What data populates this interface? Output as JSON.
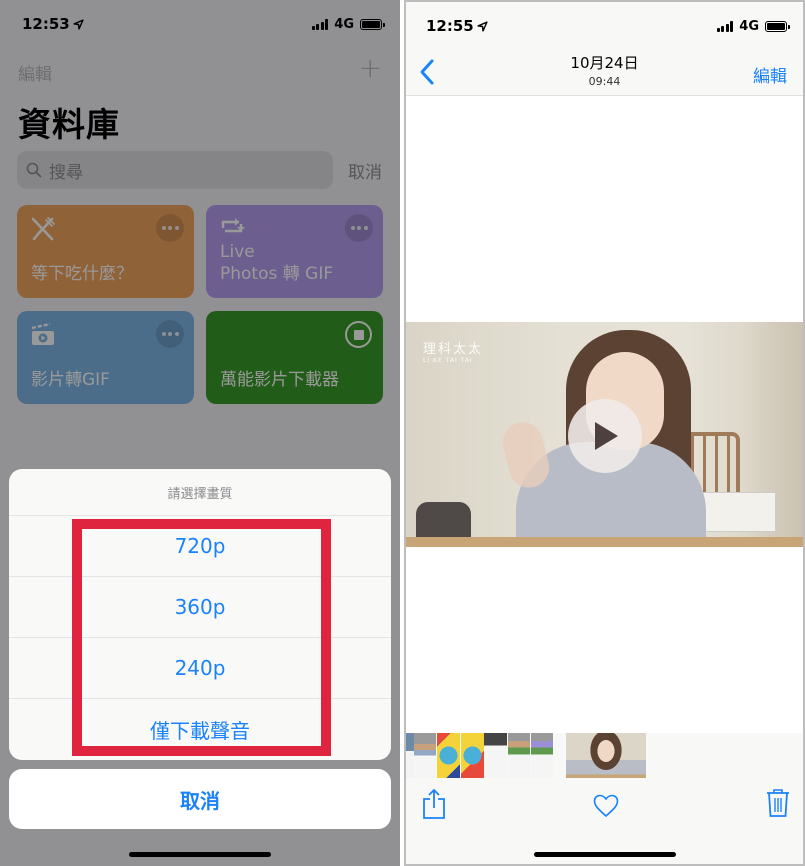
{
  "left_screen": {
    "status_bar": {
      "time": "12:53",
      "network": "4G"
    },
    "nav": {
      "edit_label": "編輯",
      "add_icon": "plus-icon"
    },
    "title": "資料庫",
    "search": {
      "placeholder": "搜尋",
      "cancel_label": "取消"
    },
    "shortcuts": [
      {
        "label": "等下吃什麼？",
        "icon": "fork-knife-icon",
        "color": "#f0a35e",
        "action": "more"
      },
      {
        "label_line1": "Live",
        "label_line2": "Photos 轉 GIF",
        "icon": "repeat-icon",
        "color": "#b59ef0",
        "action": "more"
      },
      {
        "label": "影片轉GIF",
        "icon": "video-clapper-icon",
        "color": "#7eb6e6",
        "action": "more"
      },
      {
        "label": "萬能影片下載器",
        "icon": "",
        "color": "#3a9a2a",
        "action": "stop"
      }
    ],
    "action_sheet": {
      "title": "請選擇畫質",
      "options": [
        "720p",
        "360p",
        "240p",
        "僅下載聲音"
      ],
      "cancel_label": "取消"
    },
    "highlight_color": "#df2440"
  },
  "right_screen": {
    "status_bar": {
      "time": "12:55",
      "network": "4G"
    },
    "nav": {
      "back_icon": "chevron-left-icon",
      "title": "10月24日",
      "subtitle": "09:44",
      "edit_label": "編輯"
    },
    "video": {
      "watermark_main": "理科太太",
      "watermark_sub": "LI  KE  TAI TAI",
      "play_icon": "play-icon"
    },
    "thumbnail_strip": {
      "count": 8
    },
    "toolbar": {
      "share_icon": "share-icon",
      "favorite_icon": "heart-icon",
      "delete_icon": "trash-icon"
    }
  },
  "colors": {
    "accent": "#1a82fb",
    "highlight": "#df2440"
  }
}
